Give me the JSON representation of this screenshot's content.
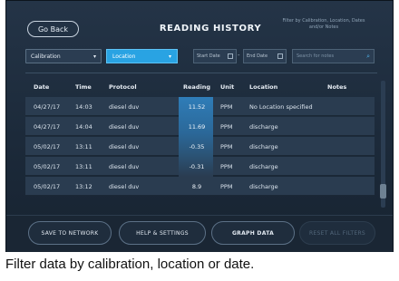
{
  "header": {
    "back_label": "Go Back",
    "title": "READING HISTORY",
    "hint": "Filter by Calibration, Location, Dates and/or Notes"
  },
  "filters": {
    "calibration_value": "Calibration",
    "location_value": "Location",
    "start_date_placeholder": "Start Date",
    "end_date_placeholder": "End Date",
    "search_placeholder": "Search for notes"
  },
  "table": {
    "columns": [
      "Date",
      "Time",
      "Protocol",
      "Reading",
      "Unit",
      "Location",
      "Notes"
    ],
    "rows": [
      {
        "date": "04/27/17",
        "time": "14:03",
        "protocol": "diesel duv",
        "reading": "11.52",
        "unit": "PPM",
        "location": "No Location specified",
        "notes": ""
      },
      {
        "date": "04/27/17",
        "time": "14:04",
        "protocol": "diesel duv",
        "reading": "11.69",
        "unit": "PPM",
        "location": "discharge",
        "notes": ""
      },
      {
        "date": "05/02/17",
        "time": "13:11",
        "protocol": "diesel duv",
        "reading": "-0.35",
        "unit": "PPM",
        "location": "discharge",
        "notes": ""
      },
      {
        "date": "05/02/17",
        "time": "13:11",
        "protocol": "diesel duv",
        "reading": "-0.31",
        "unit": "PPM",
        "location": "discharge",
        "notes": ""
      },
      {
        "date": "05/02/17",
        "time": "13:12",
        "protocol": "diesel duv",
        "reading": "8.9",
        "unit": "PPM",
        "location": "discharge",
        "notes": ""
      }
    ]
  },
  "actions": {
    "save_network": "SAVE TO NETWORK",
    "help_settings": "HELP & SETTINGS",
    "graph_data": "GRAPH DATA",
    "reset_filters": "RESET ALL FILTERS"
  },
  "caption": "Filter data by calibration, location or date.",
  "colors": {
    "accent": "#29a3e3",
    "background": "#1f2d3d"
  },
  "icons": [
    "chevron-down-icon",
    "calendar-icon",
    "search-icon"
  ]
}
